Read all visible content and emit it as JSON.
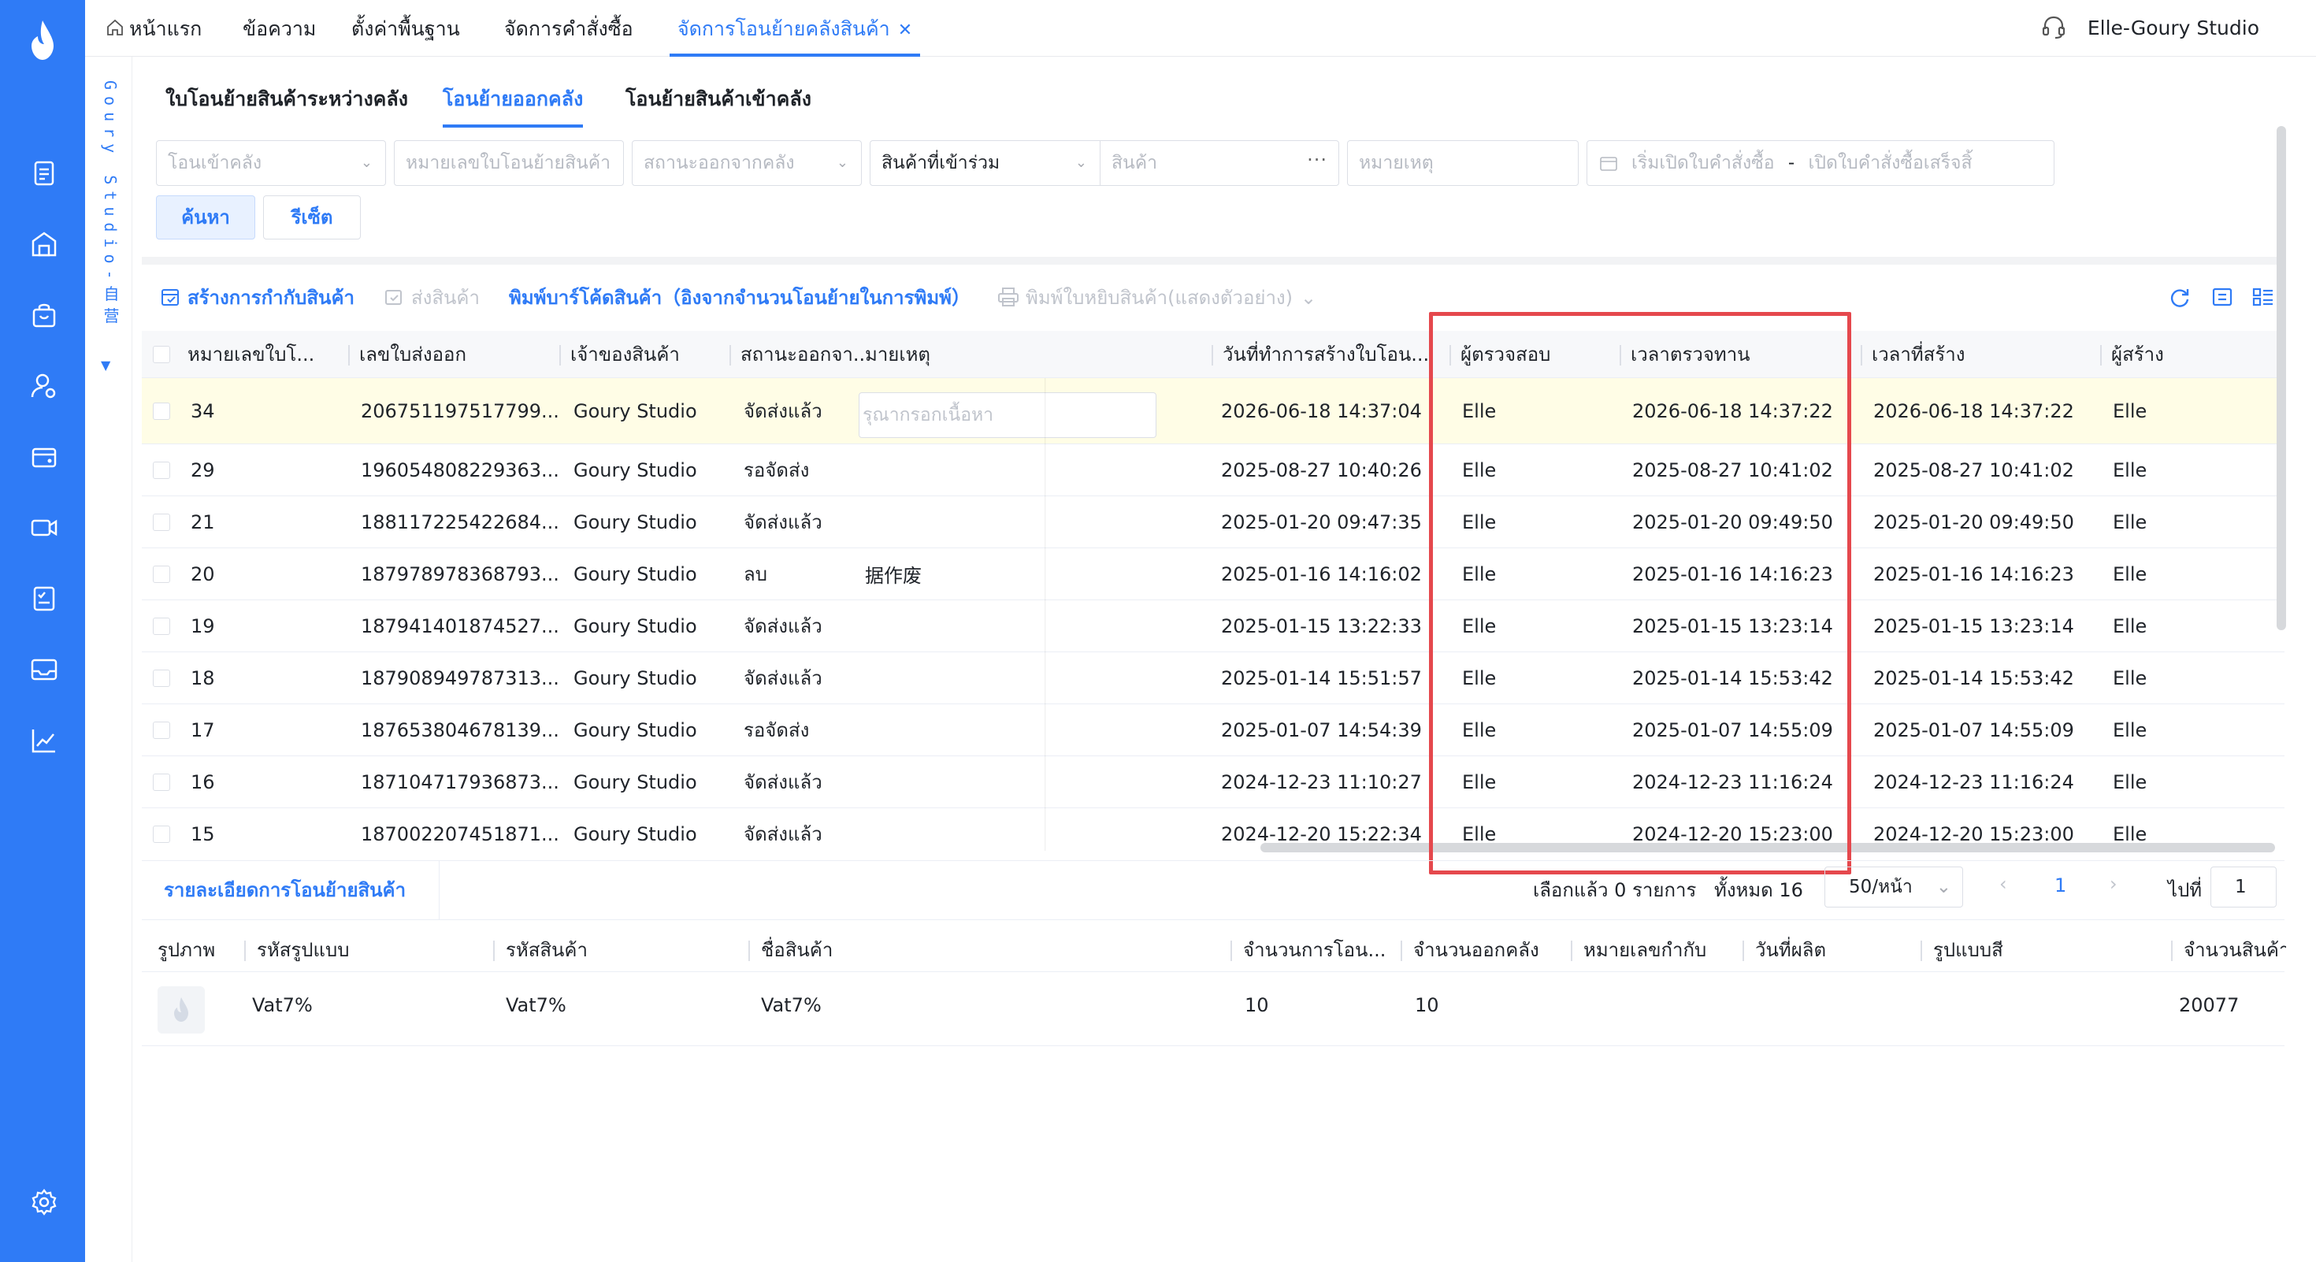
{
  "brand_vertical": "Goury Studio-自营",
  "header": {
    "tabs": [
      {
        "label": "หน้าแรก"
      },
      {
        "label": "ข้อความ"
      },
      {
        "label": "ตั้งค่าพื้นฐาน"
      },
      {
        "label": "จัดการคำสั่งซื้อ"
      },
      {
        "label": "จัดการโอนย้ายคลังสินค้า",
        "active": true
      }
    ],
    "user": "Elle-Goury Studio"
  },
  "sub_tabs": [
    {
      "label": "ใบโอนย้ายสินค้าระหว่างคลัง"
    },
    {
      "label": "โอนย้ายออกคลัง",
      "active": true
    },
    {
      "label": "โอนย้ายสินค้าเข้าคลัง"
    }
  ],
  "filters": {
    "warehouse_in": "โอนเข้าคลัง",
    "transfer_no": "หมายเลขใบโอนย้ายสินค้า",
    "outbound_status": "สถานะออกจากคลัง",
    "product_type": "สินค้าที่เข้าร่วม",
    "product": "สินค้า",
    "remark": "หมายเหตุ",
    "date_start": "เริ่มเปิดใบคำสั่งซื้อ",
    "date_sep": "-",
    "date_end": "เปิดใบคำสั่งซื้อเสร็จสิ้",
    "search_btn": "ค้นหา",
    "reset_btn": "รีเซ็ต"
  },
  "toolbar": {
    "create_shipping": "สร้างการกำกับสินค้า",
    "ship": "ส่งสินค้า",
    "print_barcode": "พิมพ์บาร์โค้ดสินค้า（อิงจากจำนวนโอนย้ายในการพิมพ์）",
    "print_picking": "พิมพ์ใบหยิบสินค้า(แสดงตัวอย่าง)"
  },
  "table": {
    "columns": [
      "หมายเลขใบโ...",
      "เลขใบส่งออก",
      "เจ้าของสินค้า",
      "สถานะออกจา...",
      "มายเหตุ",
      "วันที่ทำการสร้างใบโอน...",
      "ผู้ตรวจสอบ",
      "เวลาตรวจทาน",
      "เวลาที่สร้าง",
      "ผู้สร้าง"
    ],
    "remark_placeholder": "รุณากรอกเนื้อหา",
    "rows": [
      {
        "id": "34",
        "ship_no": "206751197517799...",
        "owner": "Goury Studio",
        "status": "จัดส่งแล้ว",
        "remark": "",
        "created_doc": "2026-06-18 14:37:04",
        "reviewer": "Elle",
        "review_time": "2026-06-18 14:37:22",
        "created_time": "2026-06-18 14:37:22",
        "creator": "Elle"
      },
      {
        "id": "29",
        "ship_no": "196054808229363...",
        "owner": "Goury Studio",
        "status": "รอจัดส่ง",
        "remark": "",
        "created_doc": "2025-08-27 10:40:26",
        "reviewer": "Elle",
        "review_time": "2025-08-27 10:41:02",
        "created_time": "2025-08-27 10:41:02",
        "creator": "Elle"
      },
      {
        "id": "21",
        "ship_no": "188117225422684...",
        "owner": "Goury Studio",
        "status": "จัดส่งแล้ว",
        "remark": "",
        "created_doc": "2025-01-20 09:47:35",
        "reviewer": "Elle",
        "review_time": "2025-01-20 09:49:50",
        "created_time": "2025-01-20 09:49:50",
        "creator": "Elle"
      },
      {
        "id": "20",
        "ship_no": "187978978368793...",
        "owner": "Goury Studio",
        "status": "ลบ",
        "remark": "据作废",
        "created_doc": "2025-01-16 14:16:02",
        "reviewer": "Elle",
        "review_time": "2025-01-16 14:16:23",
        "created_time": "2025-01-16 14:16:23",
        "creator": "Elle"
      },
      {
        "id": "19",
        "ship_no": "187941401874527...",
        "owner": "Goury Studio",
        "status": "จัดส่งแล้ว",
        "remark": "",
        "created_doc": "2025-01-15 13:22:33",
        "reviewer": "Elle",
        "review_time": "2025-01-15 13:23:14",
        "created_time": "2025-01-15 13:23:14",
        "creator": "Elle"
      },
      {
        "id": "18",
        "ship_no": "187908949787313...",
        "owner": "Goury Studio",
        "status": "จัดส่งแล้ว",
        "remark": "",
        "created_doc": "2025-01-14 15:51:57",
        "reviewer": "Elle",
        "review_time": "2025-01-14 15:53:42",
        "created_time": "2025-01-14 15:53:42",
        "creator": "Elle"
      },
      {
        "id": "17",
        "ship_no": "187653804678139...",
        "owner": "Goury Studio",
        "status": "รอจัดส่ง",
        "remark": "",
        "created_doc": "2025-01-07 14:54:39",
        "reviewer": "Elle",
        "review_time": "2025-01-07 14:55:09",
        "created_time": "2025-01-07 14:55:09",
        "creator": "Elle"
      },
      {
        "id": "16",
        "ship_no": "187104717936873...",
        "owner": "Goury Studio",
        "status": "จัดส่งแล้ว",
        "remark": "",
        "created_doc": "2024-12-23 11:10:27",
        "reviewer": "Elle",
        "review_time": "2024-12-23 11:16:24",
        "created_time": "2024-12-23 11:16:24",
        "creator": "Elle"
      },
      {
        "id": "15",
        "ship_no": "187002207451871...",
        "owner": "Goury Studio",
        "status": "จัดส่งแล้ว",
        "remark": "",
        "created_doc": "2024-12-20 15:22:34",
        "reviewer": "Elle",
        "review_time": "2024-12-20 15:23:00",
        "created_time": "2024-12-20 15:23:00",
        "creator": "Elle"
      }
    ]
  },
  "detail": {
    "tab": "รายละเอียดการโอนย้ายสินค้า",
    "selected": "เลือกแล้ว 0 รายการ",
    "total": "ทั้งหมด 16",
    "page_size": "50/หน้า",
    "current_page": "1",
    "goto_label": "ไปที่",
    "goto_value": "1",
    "columns": [
      "รูปภาพ",
      "รหัสรูปแบบ",
      "รหัสสินค้า",
      "ชื่อสินค้า",
      "จำนวนการโอน...",
      "จำนวนออกคลัง",
      "หมายเลขกำกับ",
      "วันที่ผลิต",
      "รูปแบบสี",
      "จำนวนสินค้า"
    ],
    "row": {
      "style_code": "Vat7%",
      "product_code": "Vat7%",
      "product_name": "Vat7%",
      "transfer_qty": "10",
      "out_qty": "10",
      "batch_no": "",
      "mfg_date": "",
      "color": "",
      "stock_qty": "20077"
    }
  },
  "colors": {
    "accent": "#2f7bf6",
    "highlight": "#e5484d",
    "row_highlight": "#fffde6"
  }
}
